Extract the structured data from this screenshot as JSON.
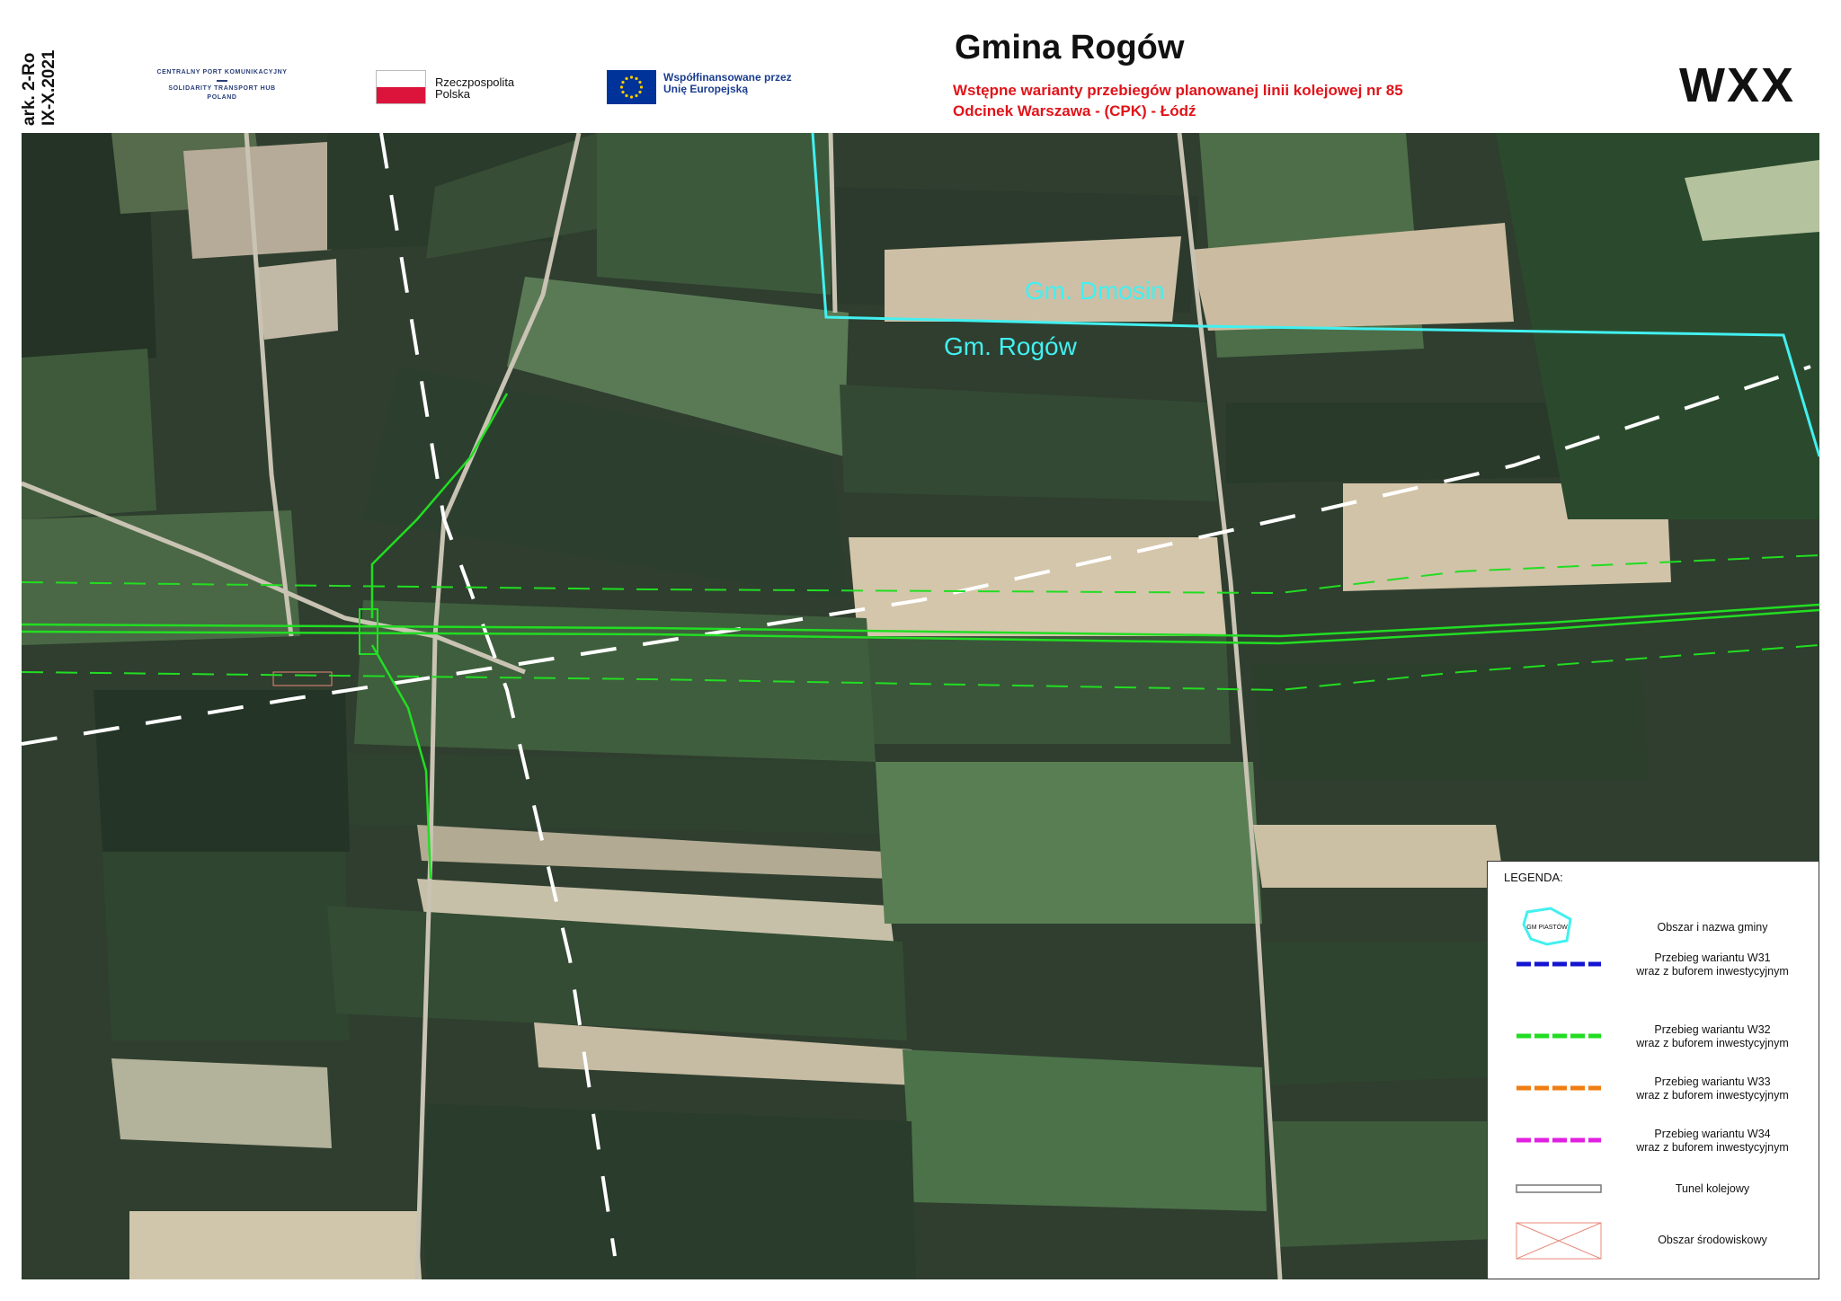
{
  "header": {
    "sheet_code_1": "ark. 2-Ro",
    "sheet_code_2": "IX-X.2021",
    "title": "Gmina Rogów",
    "subtitle_1": "Wstępne warianty przebiegów planowanej linii kolejowej nr 85",
    "subtitle_2": "Odcinek Warszawa - (CPK) - Łódź",
    "code": "WXX"
  },
  "logos": {
    "cpk_1": "CENTRALNY PORT KOMUNIKACYJNY",
    "cpk_2": "SOLIDARITY TRANSPORT HUB",
    "cpk_3": "POLAND",
    "rp_1": "Rzeczpospolita",
    "rp_2": "Polska",
    "eu_1": "Współfinansowane przez",
    "eu_2": "Unię Europejską"
  },
  "map": {
    "label_north": "Gm. Dmosin",
    "label_south": "Gm. Rogów",
    "colors": {
      "boundary": "#42f0f0",
      "w31": "#1414d2",
      "w32": "#22dd22",
      "w33": "#f07d12",
      "w34": "#e020e0",
      "tunnel": "#ffffff",
      "env_area": "#e88878"
    }
  },
  "legend": {
    "title": "LEGENDA:",
    "gmina_icon_label": "GM PIASTÓW",
    "items": [
      {
        "label_1": "Obszar i nazwa gminy",
        "label_2": ""
      },
      {
        "label_1": "Przebieg wariantu W31",
        "label_2": "wraz z buforem inwestycyjnym"
      },
      {
        "label_1": "Przebieg wariantu W32",
        "label_2": "wraz z buforem inwestycyjnym"
      },
      {
        "label_1": "Przebieg wariantu W33",
        "label_2": "wraz z buforem inwestycyjnym"
      },
      {
        "label_1": "Przebieg wariantu W34",
        "label_2": "wraz z buforem inwestycyjnym"
      },
      {
        "label_1": "Tunel kolejowy",
        "label_2": ""
      },
      {
        "label_1": "Obszar środowiskowy",
        "label_2": ""
      }
    ]
  }
}
